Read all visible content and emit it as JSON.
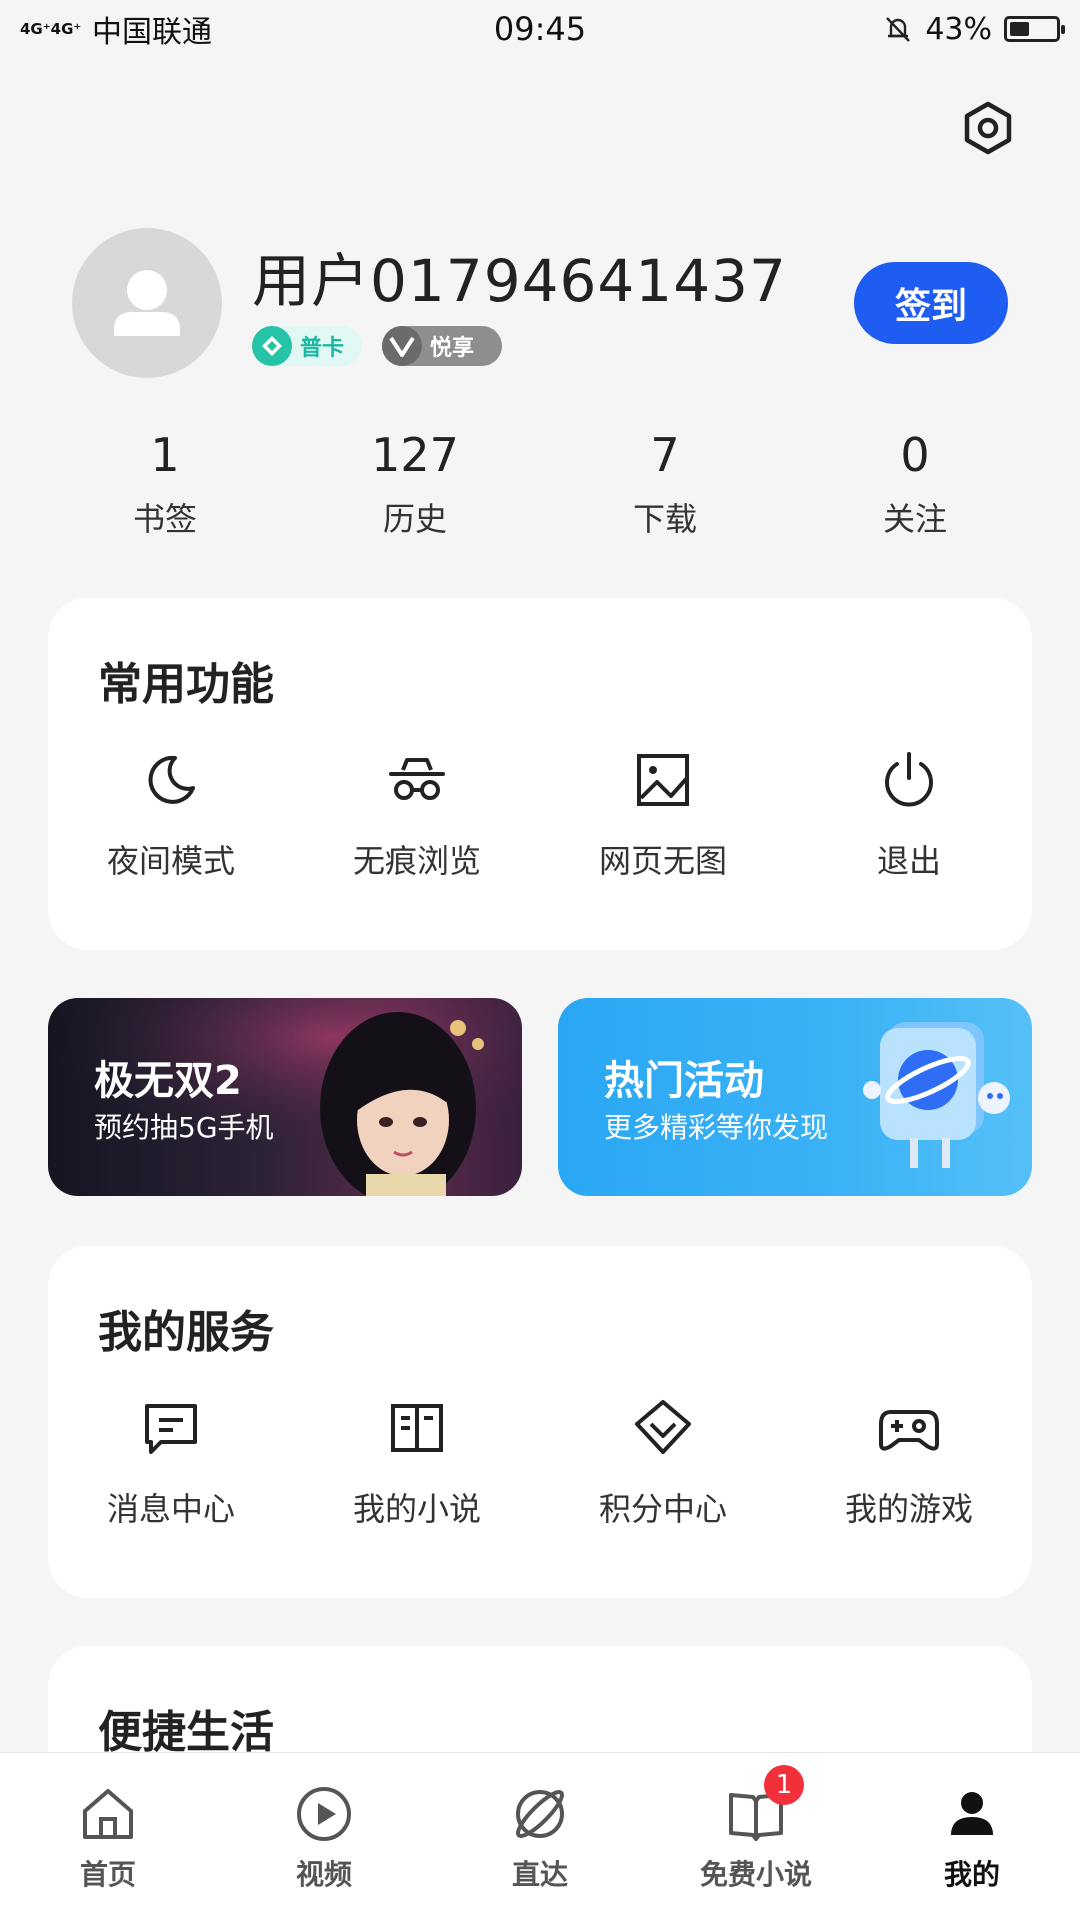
{
  "status_bar": {
    "network": "4G⁺4G⁺",
    "carrier": "中国联通",
    "time": "09:45",
    "battery": "43%",
    "battery_level": 0.43
  },
  "profile": {
    "username": "用户01794641437",
    "badges": [
      "普卡",
      "悦享"
    ],
    "signin_label": "签到"
  },
  "stats": [
    {
      "value": "1",
      "label": "书签"
    },
    {
      "value": "127",
      "label": "历史"
    },
    {
      "value": "7",
      "label": "下载"
    },
    {
      "value": "0",
      "label": "关注"
    }
  ],
  "common_functions": {
    "title": "常用功能",
    "items": [
      {
        "label": "夜间模式",
        "icon": "moon-icon"
      },
      {
        "label": "无痕浏览",
        "icon": "incognito-icon"
      },
      {
        "label": "网页无图",
        "icon": "image-icon"
      },
      {
        "label": "退出",
        "icon": "power-icon"
      }
    ]
  },
  "banners": [
    {
      "title": "极无双2",
      "subtitle": "预约抽5G手机"
    },
    {
      "title": "热门活动",
      "subtitle": "更多精彩等你发现"
    }
  ],
  "my_services": {
    "title": "我的服务",
    "items": [
      {
        "label": "消息中心",
        "icon": "message-icon"
      },
      {
        "label": "我的小说",
        "icon": "book-icon"
      },
      {
        "label": "积分中心",
        "icon": "diamond-icon"
      },
      {
        "label": "我的游戏",
        "icon": "gamepad-icon"
      }
    ]
  },
  "convenient_life": {
    "title": "便捷生活"
  },
  "tabbar": {
    "items": [
      {
        "label": "首页",
        "icon": "home-icon"
      },
      {
        "label": "视频",
        "icon": "play-icon"
      },
      {
        "label": "直达",
        "icon": "planet-icon"
      },
      {
        "label": "免费小说",
        "icon": "book-icon",
        "badge": "1"
      },
      {
        "label": "我的",
        "icon": "person-icon"
      }
    ],
    "active": "我的"
  },
  "colors": {
    "accent": "#1f5cf2",
    "badge_red": "#f2303c",
    "background": "#f5f5f5"
  }
}
